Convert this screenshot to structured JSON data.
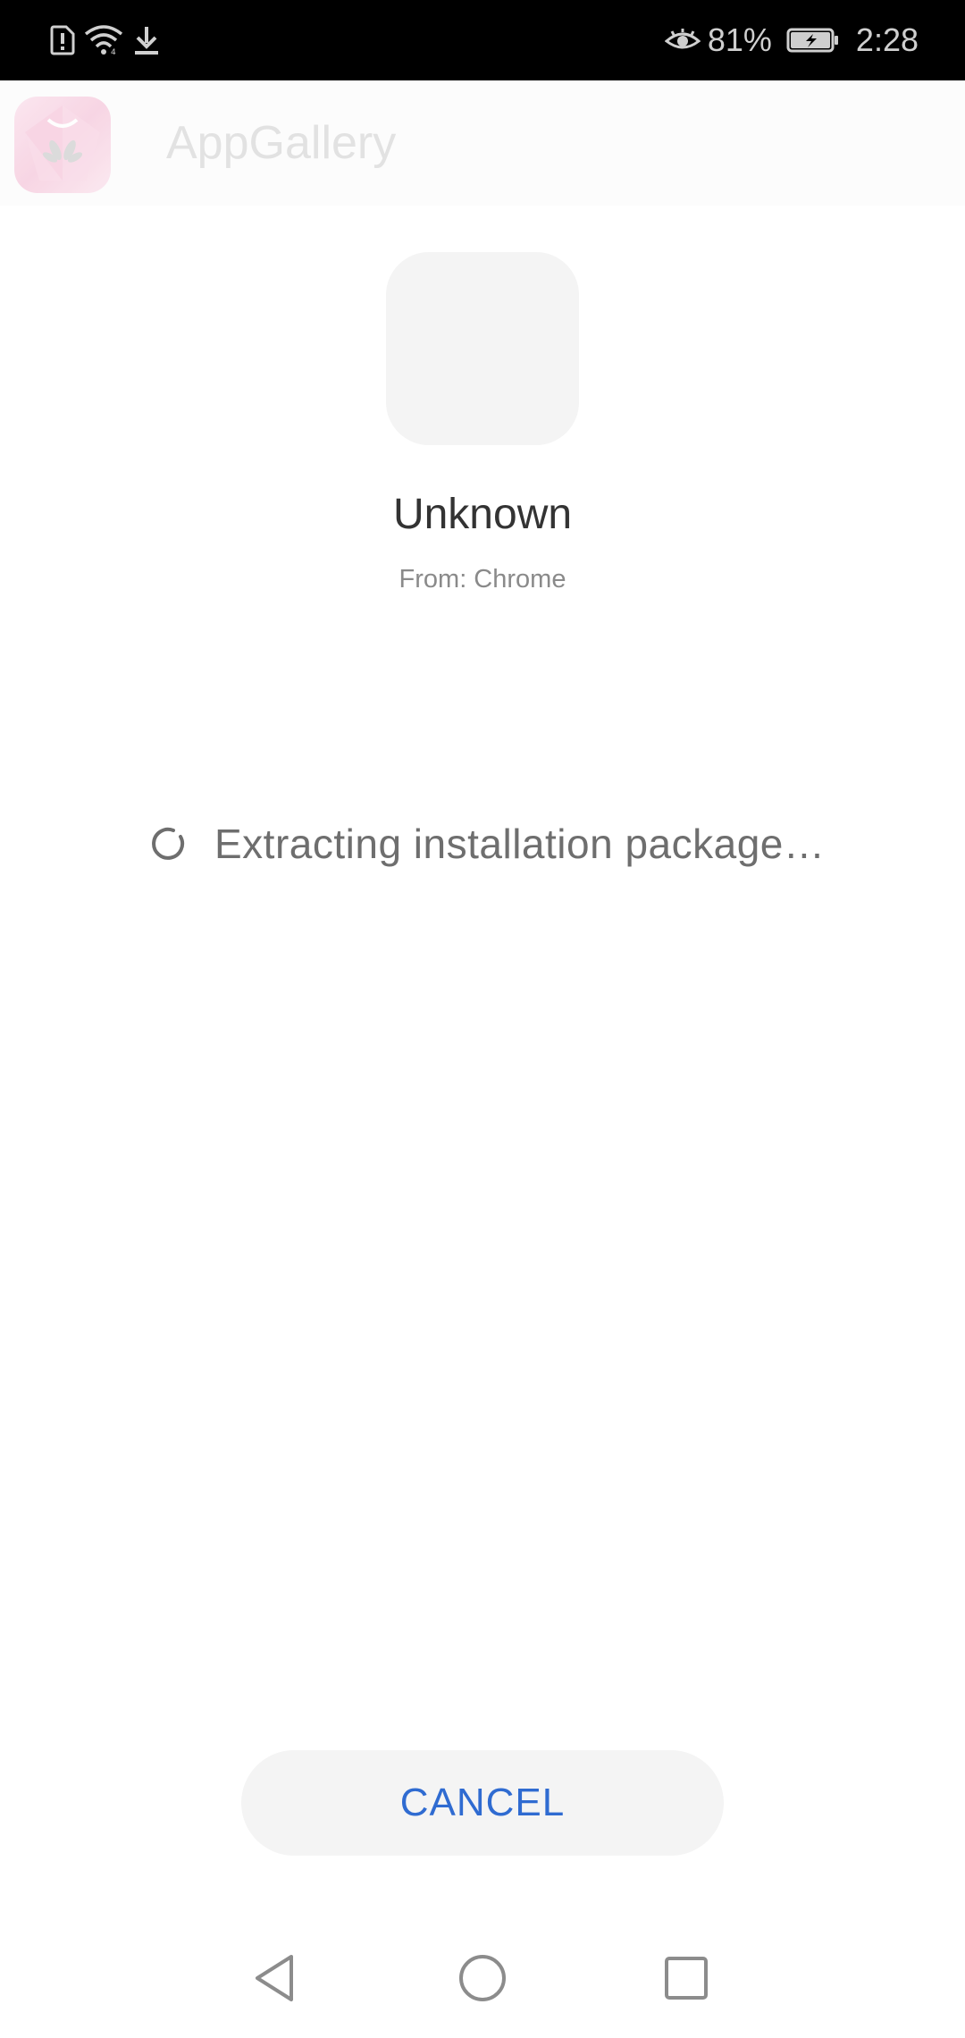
{
  "status_bar": {
    "left_icons": [
      "alert-sim-icon",
      "wifi-icon",
      "download-icon"
    ],
    "battery_percent": "81%",
    "time": "2:28",
    "right_icons": [
      "eye-comfort-icon",
      "battery-charging-icon"
    ]
  },
  "app_header": {
    "title": "AppGallery",
    "logo_icon": "appgallery-logo-icon"
  },
  "package": {
    "name": "Unknown",
    "source": "From: Chrome"
  },
  "progress": {
    "status_text": "Extracting installation package…"
  },
  "actions": {
    "cancel_label": "CANCEL"
  },
  "colors": {
    "accent": "#2f6bd1",
    "status_bar_bg": "#000000",
    "button_bg": "#f4f4f4"
  }
}
